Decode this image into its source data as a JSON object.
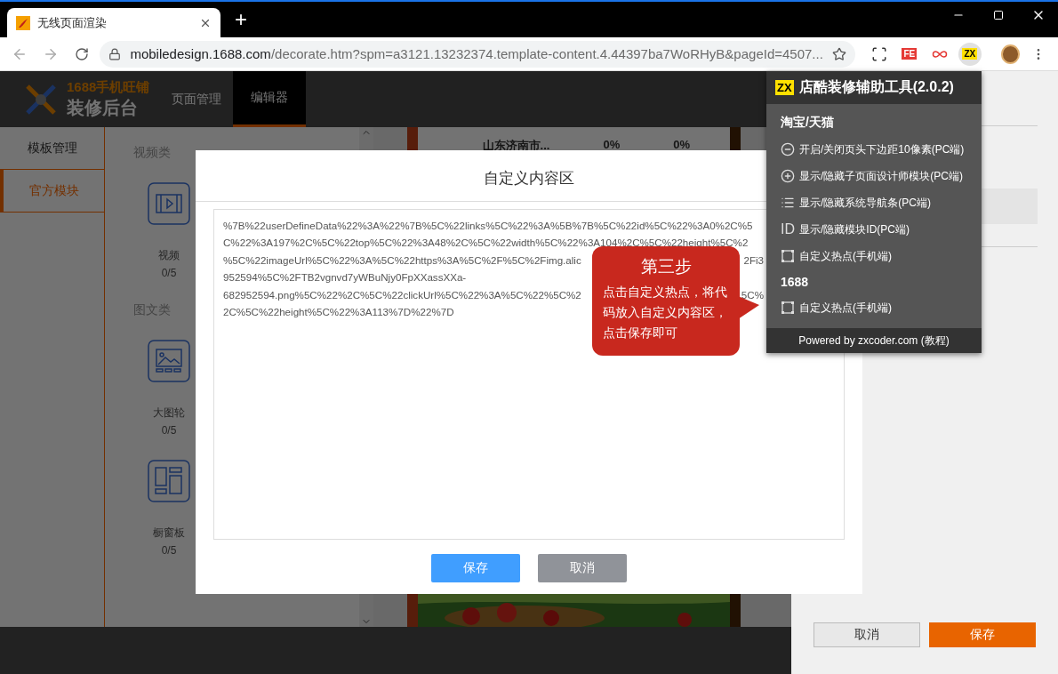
{
  "browser": {
    "tab_title": "无线页面渲染",
    "new_tab": "+",
    "url_host": "mobiledesign.1688.com",
    "url_path": "/decorate.htm?spm=a3121.13232374.template-content.4.44397ba7WoRHyB&pageId=4507...",
    "extensions": [
      {
        "kind": "screen"
      },
      {
        "kind": "badge",
        "text": "FE",
        "selected": false
      },
      {
        "kind": "infinity"
      },
      {
        "kind": "badge",
        "text": "ZX",
        "selected": true
      }
    ]
  },
  "header": {
    "logo_lines": [
      "1688手机旺铺",
      "装修后台"
    ],
    "nav": [
      {
        "label": "页面管理",
        "selected": false
      },
      {
        "label": "编辑器",
        "selected": true
      }
    ]
  },
  "sidebar": [
    {
      "label": "模板管理",
      "selected": false
    },
    {
      "label": "官方模块",
      "selected": true
    }
  ],
  "modules": [
    {
      "heading": "视频类",
      "items": [
        {
          "kind": "video",
          "name": "视频",
          "count": "0/5"
        }
      ]
    },
    {
      "heading": "图文类",
      "items": [
        {
          "kind": "carousel",
          "name": "大图轮",
          "count": "0/5"
        },
        {
          "kind": "showcase",
          "name": "橱窗板",
          "count": "0/5"
        }
      ]
    }
  ],
  "canvas": {
    "row": [
      "山东济南市...",
      "0%",
      "0%"
    ]
  },
  "right_panel": {
    "buttons": [
      {
        "kind": "secondary",
        "label": "取消"
      },
      {
        "kind": "primary",
        "label": "保存"
      }
    ]
  },
  "modal": {
    "title": "自定义内容区",
    "lines": [
      [
        "%7B%22userDefineData%22%3A%22%7B%5C%22links%5C%22%3A%5B%7B%5C%22id%5C%22%3A0%2C%5"
      ],
      [
        "C%22%3A197%2C%5C%22top%5C%22%3A48%2C%5C%22width%5C%22%3A104%2C%5C%22height%5C%2"
      ],
      [
        "%5C%22imageUrl%5C%22%3A%5C%22https%3A%5C%2F%5C%2Fimg.alic",
        "2Fi3"
      ],
      [
        "952594%5C%2FTB2vgnvd7yWBuNjy0FpXXassXXa-"
      ],
      [
        "682952594.png%5C%22%2C%5C%22clickUrl%5C%22%3A%5C%22%5C%2",
        "5C%"
      ],
      [
        "2C%5C%22height%5C%22%3A113%7D%22%7D"
      ]
    ],
    "buttons": [
      {
        "kind": "primary",
        "label": "保存"
      },
      {
        "kind": "secondary",
        "label": "取消"
      }
    ]
  },
  "callout": {
    "title": "第三步",
    "body": "点击自定义热点，将代码放入自定义内容区，点击保存即可"
  },
  "extension_popup": {
    "logo": "ZX",
    "title": "店酷装修辅助工具(2.0.2)",
    "sections": [
      {
        "heading": "淘宝/天猫",
        "items": [
          {
            "kind": "minus",
            "label": "开启/关闭页头下边距10像素(PC端)"
          },
          {
            "kind": "plus",
            "label": "显示/隐藏子页面设计师模块(PC端)"
          },
          {
            "kind": "list",
            "label": "显示/隐藏系统导航条(PC端)"
          },
          {
            "kind": "text",
            "icon_text": "ID",
            "label": "显示/隐藏模块ID(PC端)"
          },
          {
            "kind": "frame",
            "label": "自定义热点(手机端)"
          }
        ]
      },
      {
        "heading": "1688",
        "items": [
          {
            "kind": "frame",
            "label": "自定义热点(手机端)"
          }
        ]
      }
    ],
    "footer": "Powered by zxcoder.com (教程)"
  }
}
